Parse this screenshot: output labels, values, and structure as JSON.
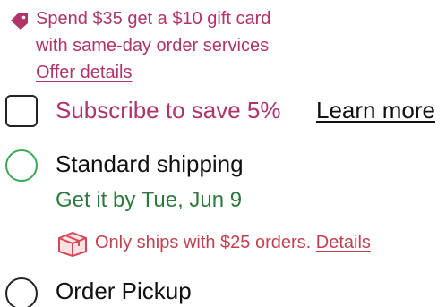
{
  "promo": {
    "icon": "tag-icon",
    "text": "Spend $35 get a $10 gift card with same-day order services",
    "link_label": "Offer details",
    "color": "#b0336b"
  },
  "subscribe": {
    "label": "Subscribe to save 5%",
    "link_label": "Learn more",
    "checked": false
  },
  "shipping_options": {
    "standard": {
      "label": "Standard shipping",
      "arrival_prefix": "Get it by",
      "arrival_date": "Tue, Jun 9",
      "note_icon": "box-icon",
      "note_text": "Only ships with $25 orders.",
      "note_link": "Details",
      "accent": "#3aa757"
    },
    "pickup": {
      "label": "Order Pickup"
    }
  }
}
